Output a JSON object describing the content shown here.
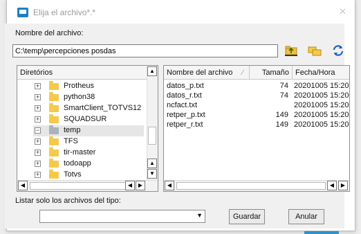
{
  "dialog": {
    "title": "Elija el archivo*.*",
    "close_glyph": "✕"
  },
  "file_name_label": "Nombre del archivo:",
  "path_value": "C:\\temp\\percepciones posdas",
  "toolbar": {
    "up_icon": "folder-up-icon",
    "new_folder_icon": "new-folder-icon",
    "refresh_icon": "refresh-icon"
  },
  "tree": {
    "header": "Diretórios",
    "items": [
      {
        "label": "Protheus",
        "selected": false
      },
      {
        "label": "python38",
        "selected": false
      },
      {
        "label": "SmartClient_TOTVS12",
        "selected": false
      },
      {
        "label": "SQUADSUR",
        "selected": false
      },
      {
        "label": "temp",
        "selected": true
      },
      {
        "label": "TFS",
        "selected": false
      },
      {
        "label": "tir-master",
        "selected": false
      },
      {
        "label": "todoapp",
        "selected": false
      },
      {
        "label": "Totvs",
        "selected": false
      }
    ]
  },
  "files": {
    "headers": {
      "name": "Nombre del archivo",
      "size": "Tamaño",
      "date": "Fecha/Hora"
    },
    "rows": [
      {
        "name": "datos_p.txt",
        "size": "74",
        "date": "20201005 15:20"
      },
      {
        "name": "datos_r.txt",
        "size": "74",
        "date": "20201005 15:20"
      },
      {
        "name": "ncfact.txt",
        "size": "",
        "date": "20201005 15:20"
      },
      {
        "name": "retper_p.txt",
        "size": "149",
        "date": "20201005 15:20"
      },
      {
        "name": "retper_r.txt",
        "size": "149",
        "date": "20201005 15:20"
      }
    ]
  },
  "filter_label": "Listar solo los archivos del tipo:",
  "filter_value": "",
  "buttons": {
    "save": "Guardar",
    "cancel": "Anular"
  },
  "colors": {
    "accent": "#1c7fc4",
    "folder": "#f5c94a",
    "selected_folder": "#a9b3ba"
  }
}
